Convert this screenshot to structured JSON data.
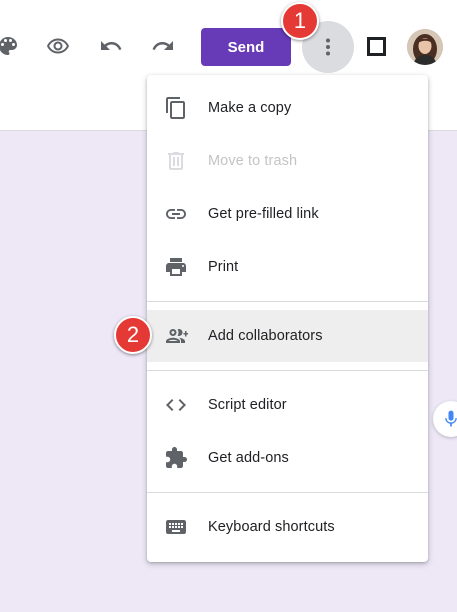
{
  "toolbar": {
    "icons": [
      "palette-icon",
      "eye-icon",
      "undo-icon",
      "redo-icon",
      "more-vert-icon",
      "square-icon"
    ],
    "send_label": "Send",
    "accent_color": "#673ab7"
  },
  "annotations": {
    "step1": "1",
    "step2": "2",
    "badge_color": "#e53935"
  },
  "menu": {
    "items": [
      {
        "label": "Make a copy",
        "icon": "copy-icon",
        "enabled": true
      },
      {
        "label": "Move to trash",
        "icon": "trash-icon",
        "enabled": false
      },
      {
        "label": "Get pre-filled link",
        "icon": "link-icon",
        "enabled": true
      },
      {
        "label": "Print",
        "icon": "printer-icon",
        "enabled": true
      },
      {
        "label": "Add collaborators",
        "icon": "add-people-icon",
        "enabled": true,
        "highlighted": true
      },
      {
        "label": "Script editor",
        "icon": "code-icon",
        "enabled": true
      },
      {
        "label": "Get add-ons",
        "icon": "puzzle-icon",
        "enabled": true
      },
      {
        "label": "Keyboard shortcuts",
        "icon": "keyboard-icon",
        "enabled": true
      }
    ]
  },
  "background_color": "#ede7f6"
}
